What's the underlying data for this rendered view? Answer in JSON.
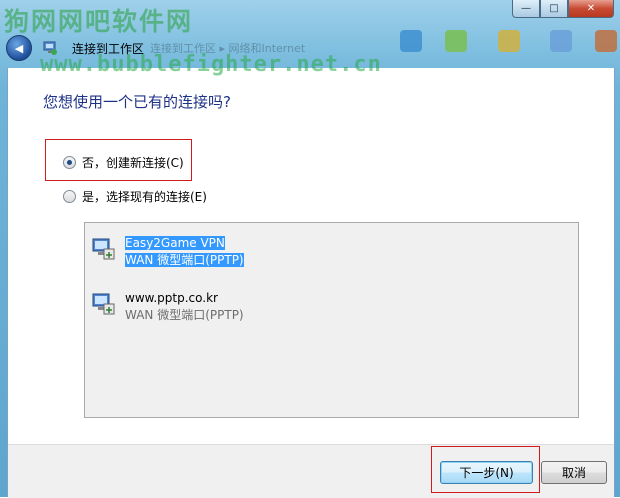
{
  "window": {
    "title": "连接到工作区",
    "watermark_top": "狗网网吧软件网",
    "watermark_url": "www.bubblefighter.net.cn",
    "nav_ghost": "连接到工作区 ▸ 网络和Internet"
  },
  "caption": {
    "minimize": "—",
    "maximize": "□",
    "close": "✕"
  },
  "nav": {
    "back_icon": "◀"
  },
  "page": {
    "question": "您想使用一个已有的连接吗?",
    "options": [
      {
        "label": "否，创建新连接(C)",
        "checked": true
      },
      {
        "label": "是，选择现有的连接(E)",
        "checked": false
      }
    ]
  },
  "connections": [
    {
      "name": "Easy2Game VPN",
      "type": "WAN 微型端口(PPTP)",
      "selected": true
    },
    {
      "name": "www.pptp.co.kr",
      "type": "WAN 微型端口(PPTP)",
      "selected": false
    }
  ],
  "footer": {
    "next_label": "下一步(N)",
    "cancel_label": "取消"
  },
  "colors": {
    "heading": "#1e3287",
    "highlight": "#d21c1c",
    "selection": "#3399ff"
  },
  "icons": [
    "back-arrow-icon",
    "wizard-network-icon",
    "network-connection-icon"
  ]
}
